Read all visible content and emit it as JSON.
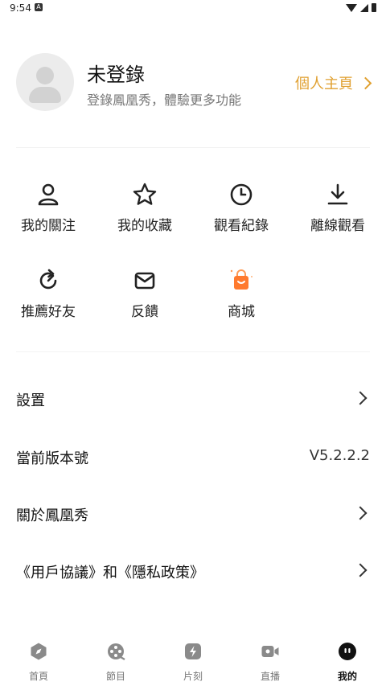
{
  "status": {
    "time": "9:54",
    "notification_icon": "A"
  },
  "profile": {
    "name": "未登錄",
    "subtitle": "登錄鳳凰秀，體驗更多功能",
    "link_label": "個人主頁"
  },
  "grid": [
    {
      "label": "我的關注",
      "icon": "person-icon"
    },
    {
      "label": "我的收藏",
      "icon": "star-icon"
    },
    {
      "label": "觀看紀錄",
      "icon": "clock-icon"
    },
    {
      "label": "離線觀看",
      "icon": "download-icon"
    },
    {
      "label": "推薦好友",
      "icon": "refresh-icon"
    },
    {
      "label": "反饋",
      "icon": "mail-icon"
    },
    {
      "label": "商城",
      "icon": "shopping-bag-icon"
    }
  ],
  "settings": [
    {
      "label": "設置",
      "value": ""
    },
    {
      "label": "當前版本號",
      "value": "V5.2.2.2"
    },
    {
      "label": "關於鳳凰秀",
      "value": ""
    },
    {
      "label": "《用戶協議》和《隱私政策》",
      "value": ""
    }
  ],
  "tabs": [
    {
      "label": "首頁",
      "icon": "compass-icon"
    },
    {
      "label": "節目",
      "icon": "film-reel-icon"
    },
    {
      "label": "片刻",
      "icon": "lightning-icon"
    },
    {
      "label": "直播",
      "icon": "video-camera-icon"
    },
    {
      "label": "我的",
      "icon": "profile-face-icon"
    }
  ],
  "colors": {
    "accent_gold": "#e0a030",
    "shop_orange": "#ff7a2e"
  }
}
